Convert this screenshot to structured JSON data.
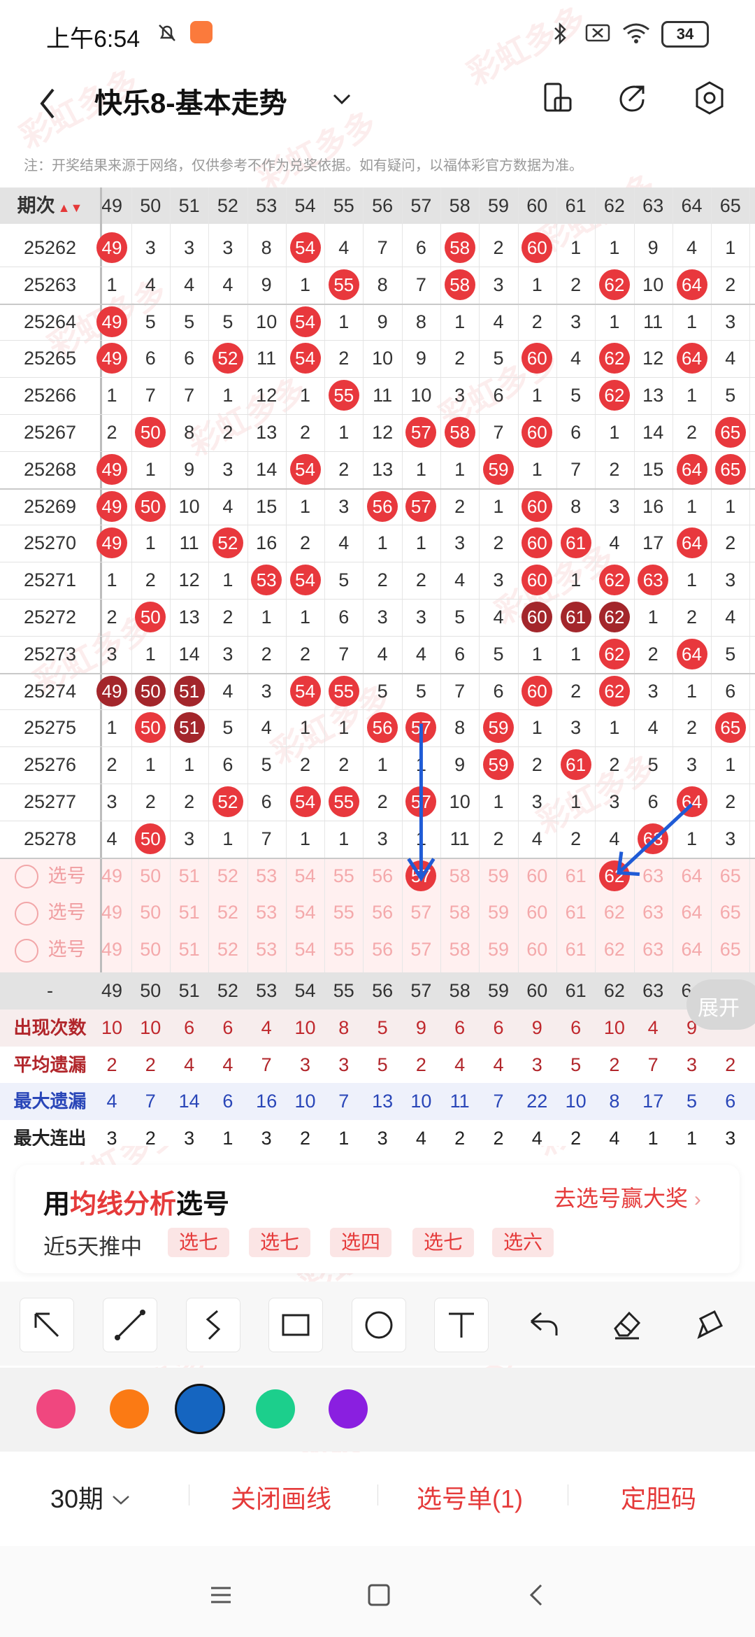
{
  "status_bar": {
    "time": "上午6:54",
    "battery": "34"
  },
  "header": {
    "title": "快乐8-基本走势"
  },
  "notice": "注：开奖结果来源于网络，仅供参考不作为兑奖依据。如有疑问，以福体彩官方数据为准。",
  "table": {
    "period_header": "期次",
    "columns": [
      "49",
      "50",
      "51",
      "52",
      "53",
      "54",
      "55",
      "56",
      "57",
      "58",
      "59",
      "60",
      "61",
      "62",
      "63",
      "64",
      "65"
    ],
    "rows": [
      {
        "period": "25262",
        "cells": [
          "49",
          "3",
          "3",
          "3",
          "8",
          "54",
          "4",
          "7",
          "6",
          "58",
          "2",
          "60",
          "1",
          "1",
          "9",
          "4",
          "1"
        ]
      },
      {
        "period": "25263",
        "cells": [
          "1",
          "4",
          "4",
          "4",
          "9",
          "1",
          "55",
          "8",
          "7",
          "58",
          "3",
          "1",
          "2",
          "62",
          "10",
          "64",
          "2"
        ]
      },
      {
        "period": "25264",
        "cells": [
          "49",
          "5",
          "5",
          "5",
          "10",
          "54",
          "1",
          "9",
          "8",
          "1",
          "4",
          "2",
          "3",
          "1",
          "11",
          "1",
          "3"
        ]
      },
      {
        "period": "25265",
        "cells": [
          "49",
          "6",
          "6",
          "52",
          "11",
          "54",
          "2",
          "10",
          "9",
          "2",
          "5",
          "60",
          "4",
          "62",
          "12",
          "64",
          "4"
        ]
      },
      {
        "period": "25266",
        "cells": [
          "1",
          "7",
          "7",
          "1",
          "12",
          "1",
          "55",
          "11",
          "10",
          "3",
          "6",
          "1",
          "5",
          "62",
          "13",
          "1",
          "5"
        ]
      },
      {
        "period": "25267",
        "cells": [
          "2",
          "50",
          "8",
          "2",
          "13",
          "2",
          "1",
          "12",
          "57",
          "58",
          "7",
          "60",
          "6",
          "1",
          "14",
          "2",
          "65"
        ]
      },
      {
        "period": "25268",
        "cells": [
          "49",
          "1",
          "9",
          "3",
          "14",
          "54",
          "2",
          "13",
          "1",
          "1",
          "59",
          "1",
          "7",
          "2",
          "15",
          "64",
          "65"
        ]
      },
      {
        "period": "25269",
        "cells": [
          "49",
          "50",
          "10",
          "4",
          "15",
          "1",
          "3",
          "56",
          "57",
          "2",
          "1",
          "60",
          "8",
          "3",
          "16",
          "1",
          "1"
        ]
      },
      {
        "period": "25270",
        "cells": [
          "49",
          "1",
          "11",
          "52",
          "16",
          "2",
          "4",
          "1",
          "1",
          "3",
          "2",
          "60",
          "61",
          "4",
          "17",
          "64",
          "2"
        ]
      },
      {
        "period": "25271",
        "cells": [
          "1",
          "2",
          "12",
          "1",
          "53",
          "54",
          "5",
          "2",
          "2",
          "4",
          "3",
          "60",
          "1",
          "62",
          "63",
          "1",
          "3"
        ]
      },
      {
        "period": "25272",
        "cells": [
          "2",
          "50",
          "13",
          "2",
          "1",
          "1",
          "6",
          "3",
          "3",
          "5",
          "4",
          "60",
          "61",
          "62",
          "1",
          "2",
          "4"
        ]
      },
      {
        "period": "25273",
        "cells": [
          "3",
          "1",
          "14",
          "3",
          "2",
          "2",
          "7",
          "4",
          "4",
          "6",
          "5",
          "1",
          "1",
          "62",
          "2",
          "64",
          "5"
        ]
      },
      {
        "period": "25274",
        "cells": [
          "49",
          "50",
          "51",
          "4",
          "3",
          "54",
          "55",
          "5",
          "5",
          "7",
          "6",
          "60",
          "2",
          "62",
          "3",
          "1",
          "6"
        ]
      },
      {
        "period": "25275",
        "cells": [
          "1",
          "50",
          "51",
          "5",
          "4",
          "1",
          "1",
          "56",
          "57",
          "8",
          "59",
          "1",
          "3",
          "1",
          "4",
          "2",
          "65"
        ]
      },
      {
        "period": "25276",
        "cells": [
          "2",
          "1",
          "1",
          "6",
          "5",
          "2",
          "2",
          "1",
          "1",
          "9",
          "59",
          "2",
          "61",
          "2",
          "5",
          "3",
          "1"
        ]
      },
      {
        "period": "25277",
        "cells": [
          "3",
          "2",
          "2",
          "52",
          "6",
          "54",
          "55",
          "2",
          "57",
          "10",
          "1",
          "3",
          "1",
          "3",
          "6",
          "64",
          "2"
        ]
      },
      {
        "period": "25278",
        "cells": [
          "4",
          "50",
          "3",
          "1",
          "7",
          "1",
          "1",
          "3",
          "1",
          "11",
          "2",
          "4",
          "2",
          "4",
          "63",
          "1",
          "3"
        ]
      }
    ],
    "select_label": "选号",
    "footer_dash": "-",
    "stats": [
      {
        "label": "出现次数",
        "values": [
          "10",
          "10",
          "6",
          "6",
          "4",
          "10",
          "8",
          "5",
          "9",
          "6",
          "6",
          "9",
          "6",
          "10",
          "4",
          "9",
          ""
        ]
      },
      {
        "label": "平均遗漏",
        "values": [
          "2",
          "2",
          "4",
          "4",
          "7",
          "3",
          "3",
          "5",
          "2",
          "4",
          "4",
          "3",
          "5",
          "2",
          "7",
          "3",
          "2"
        ]
      },
      {
        "label": "最大遗漏",
        "values": [
          "4",
          "7",
          "14",
          "6",
          "16",
          "10",
          "7",
          "13",
          "10",
          "11",
          "7",
          "22",
          "10",
          "8",
          "17",
          "5",
          "6"
        ]
      },
      {
        "label": "最大连出",
        "values": [
          "3",
          "2",
          "3",
          "1",
          "3",
          "2",
          "1",
          "3",
          "4",
          "2",
          "2",
          "4",
          "2",
          "4",
          "1",
          "1",
          "3"
        ]
      }
    ],
    "expand_label": "展开"
  },
  "promo": {
    "title_prefix": "用",
    "title_highlight": "均线分析",
    "title_suffix": "选号",
    "link": "去选号赢大奖",
    "subtitle": "近5天推中",
    "chips": [
      "选七",
      "选七",
      "选四",
      "选七",
      "选六"
    ]
  },
  "colors": [
    "#f0477f",
    "#fb7a14",
    "#1565c0",
    "#1ccf8c",
    "#8a1fe0"
  ],
  "bottom_bar": {
    "period_select": "30期",
    "close_draw": "关闭画线",
    "pick_list": "选号单(1)",
    "fixed_code": "定胆码"
  },
  "watermark": "彩虹多多"
}
